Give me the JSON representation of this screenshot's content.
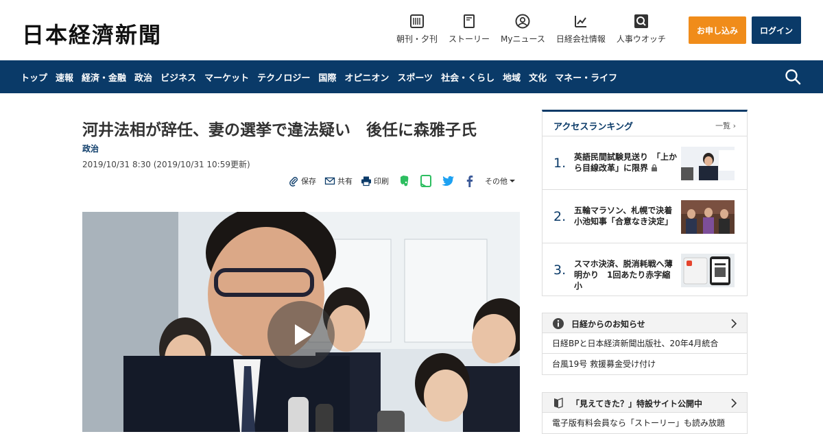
{
  "header": {
    "logo_text": "日本経濟新聞",
    "nav": [
      {
        "label": "朝刊・夕刊",
        "icon": "newspaper-icon"
      },
      {
        "label": "ストーリー",
        "icon": "book-icon"
      },
      {
        "label": "Myニュース",
        "icon": "user-icon"
      },
      {
        "label": "日経会社情報",
        "icon": "chart-icon"
      },
      {
        "label": "人事ウオッチ",
        "icon": "search-person-icon"
      }
    ],
    "subscribe_label": "お申し込み",
    "login_label": "ログイン"
  },
  "navbar": {
    "items": [
      "トップ",
      "速報",
      "経済・金融",
      "政治",
      "ビジネス",
      "マーケット",
      "テクノロジー",
      "国際",
      "オピニオン",
      "スポーツ",
      "社会・くらし",
      "地域",
      "文化",
      "マネー・ライフ"
    ]
  },
  "article": {
    "title": "河井法相が辞任、妻の選挙で違法疑い　後任に森雅子氏",
    "category": "政治",
    "date": "2019/10/31 8:30 (2019/10/31 10:59更新)",
    "share": {
      "save_label": "保存",
      "share_label": "共有",
      "print_label": "印刷",
      "more_label": "その他"
    }
  },
  "ranking": {
    "title": "アクセスランキング",
    "more_label": "一覧",
    "items": [
      {
        "rank": "1.",
        "text": "英語民間試験見送り　「上から目線改革」に限界",
        "locked": true
      },
      {
        "rank": "2.",
        "text": "五輪マラソン、札幌で決着　小池知事「合意なき決定」",
        "locked": false
      },
      {
        "rank": "3.",
        "text": "スマホ決済、脱消耗戦へ薄明かり　1回あたり赤字縮小",
        "locked": false
      }
    ]
  },
  "notice": {
    "title": "日経からのお知らせ",
    "items": [
      "日経BPと日本経済新聞出版社、20年4月統合",
      "台風19号 救援募金受け付け"
    ]
  },
  "promo": {
    "title": "「見えてきた？」特設サイト公開中",
    "items": [
      "電子版有料会員なら「ストーリー」も読み放題"
    ]
  },
  "colors": {
    "brand_navy": "#0a3a68",
    "subscribe_orange": "#f08c1a",
    "evernote_green": "#2dbe60",
    "twitter_blue": "#1da1f2",
    "facebook_blue": "#3b5998"
  }
}
